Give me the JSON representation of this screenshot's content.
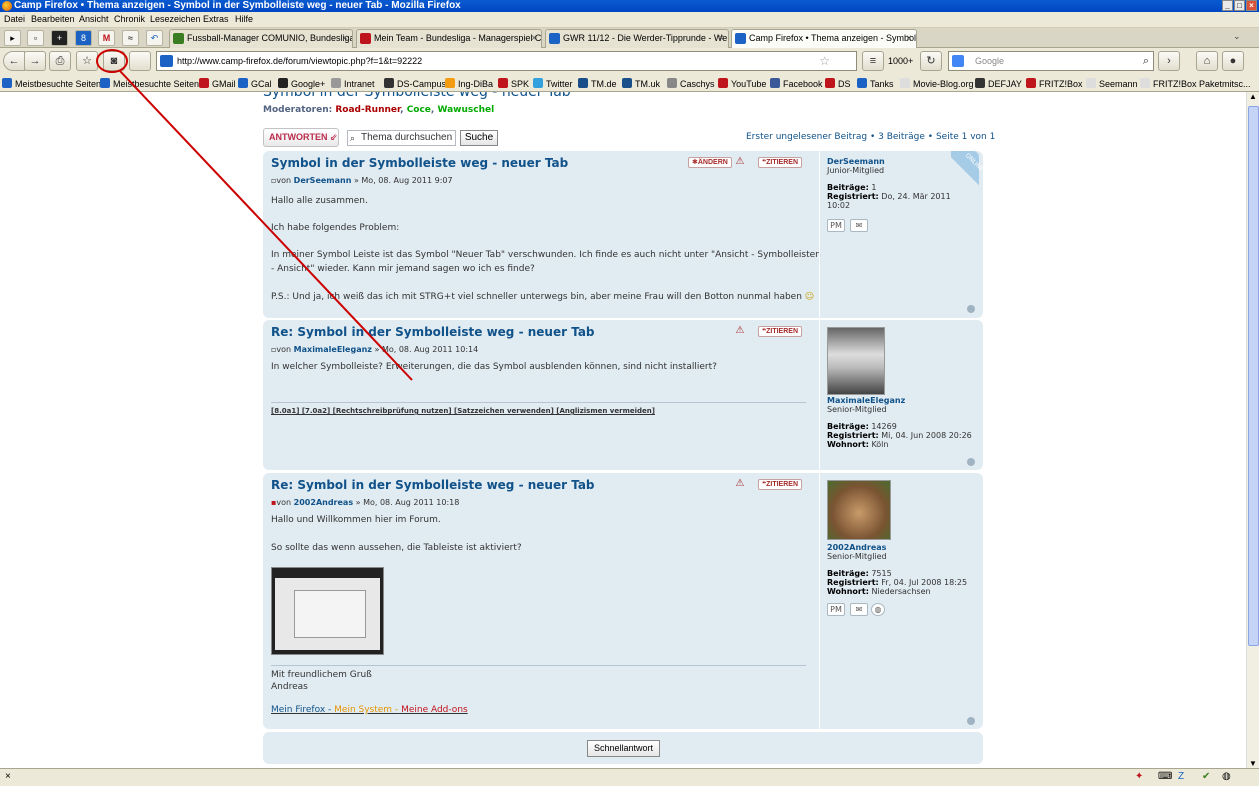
{
  "window": {
    "title": "Camp Firefox • Thema anzeigen - Symbol in der Symbolleiste weg - neuer Tab - Mozilla Firefox"
  },
  "menu": [
    "Datei",
    "Bearbeiten",
    "Ansicht",
    "Chronik",
    "Lesezeichen",
    "Extras",
    "Hilfe"
  ],
  "tabs": [
    {
      "label": "Fussball-Manager COMUNIO, Bundesliga ...",
      "color": "#3b7d23"
    },
    {
      "label": "Mein Team - Bundesliga - Managerspiel Cl...",
      "color": "#c0141c"
    },
    {
      "label": "GWR 11/12 - Die Werder-Tipprunde - We...",
      "color": "#1b62c4"
    },
    {
      "label": "Camp Firefox • Thema anzeigen - Symbol...",
      "color": "#1b62c4"
    }
  ],
  "nav": {
    "url": "http://www.camp-firefox.de/forum/viewtopic.php?f=1&t=92222",
    "search_placeholder": "Google",
    "counter": "1000+"
  },
  "bookmarks": [
    "Meistbesuchte Seiten",
    "Meistbesuchte Seiten",
    "GMail",
    "GCal",
    "Google+",
    "Intranet",
    "DS-Campus",
    "Ing-DiBa",
    "SPK",
    "Twitter",
    "TM.de",
    "TM.uk",
    "Caschys",
    "YouTube",
    "Facebook",
    "DS",
    "Tanks",
    "Movie-Blog.org",
    "DEFJAY",
    "FRITZ!Box",
    "Seemann",
    "FRITZ!Box Paketmitsc..."
  ],
  "forum": {
    "topic_title": "Symbol in der Symbolleiste weg - neuer Tab",
    "mods_label": "Moderatoren:",
    "mods": [
      "Road-Runner",
      "Coce",
      "Wawuschel"
    ],
    "reply_label": "ANTWORTEN",
    "search_placeholder": "Thema durchsuchen",
    "search_button": "Suche",
    "pager": "Erster ungelesener Beitrag • 3 Beiträge • Seite 1 von 1",
    "quick_reply": "Schnellantwort"
  },
  "posts": [
    {
      "title": "Symbol in der Symbolleiste weg - neuer Tab",
      "by": "von",
      "author": "DerSeemann",
      "date": "» Mo, 08. Aug 2011 9:07",
      "body": [
        "Hallo alle zusammen.",
        "Ich habe folgendes Problem:",
        "In meiner Symbol Leiste ist das Symbol \"Neuer Tab\" verschwunden. Ich finde es auch nicht unter \"Ansicht - Symbolleisten",
        "- Ansicht\" wieder. Kann mir jemand sagen wo ich es finde?",
        "P.S.: Und ja, ich weiß das ich mit STRG+t viel schneller unterwegs bin, aber meine Frau will den Botton nunmal haben"
      ],
      "edit": "ÄNDERN",
      "quote": "ZITIEREN",
      "online": "ONLINE",
      "profile": {
        "name": "DerSeemann",
        "rank": "Junior-Mitglied",
        "posts_label": "Beiträge:",
        "posts": "1",
        "reg_label": "Registriert:",
        "reg": "Do, 24. Mär 2011",
        "reg2": "10:02"
      }
    },
    {
      "title": "Re: Symbol in der Symbolleiste weg - neuer Tab",
      "by": "von",
      "author": "MaximaleEleganz",
      "date": "» Mo, 08. Aug 2011 10:14",
      "body": [
        "In welcher Symbolleiste? Erweiterungen, die das Symbol ausblenden können, sind nicht installiert?"
      ],
      "sig": "[8.0a1] [7.0a2] [Rechtschreibprüfung nutzen] [Satzzeichen verwenden] [Anglizismen vermeiden]",
      "quote": "ZITIEREN",
      "profile": {
        "name": "MaximaleEleganz",
        "rank": "Senior-Mitglied",
        "posts_label": "Beiträge:",
        "posts": "14269",
        "reg_label": "Registriert:",
        "reg": "Mi, 04. Jun 2008 20:26",
        "loc_label": "Wohnort:",
        "loc": "Köln"
      }
    },
    {
      "title": "Re: Symbol in der Symbolleiste weg - neuer Tab",
      "by": "von",
      "author": "2002Andreas",
      "date": "» Mo, 08. Aug 2011 10:18",
      "body": [
        "Hallo und Willkommen hier im Forum.",
        "So sollte das wenn aussehen, die Tableiste ist aktiviert?"
      ],
      "sig": [
        "Mit freundlichem Gruß",
        "Andreas"
      ],
      "links": [
        "Mein Firefox -",
        "Mein System -",
        "Meine Add-ons"
      ],
      "quote": "ZITIEREN",
      "profile": {
        "name": "2002Andreas",
        "rank": "Senior-Mitglied",
        "posts_label": "Beiträge:",
        "posts": "7515",
        "reg_label": "Registriert:",
        "reg": "Fr, 04. Jul 2008 18:25",
        "loc_label": "Wohnort:",
        "loc": "Niedersachsen"
      }
    }
  ]
}
